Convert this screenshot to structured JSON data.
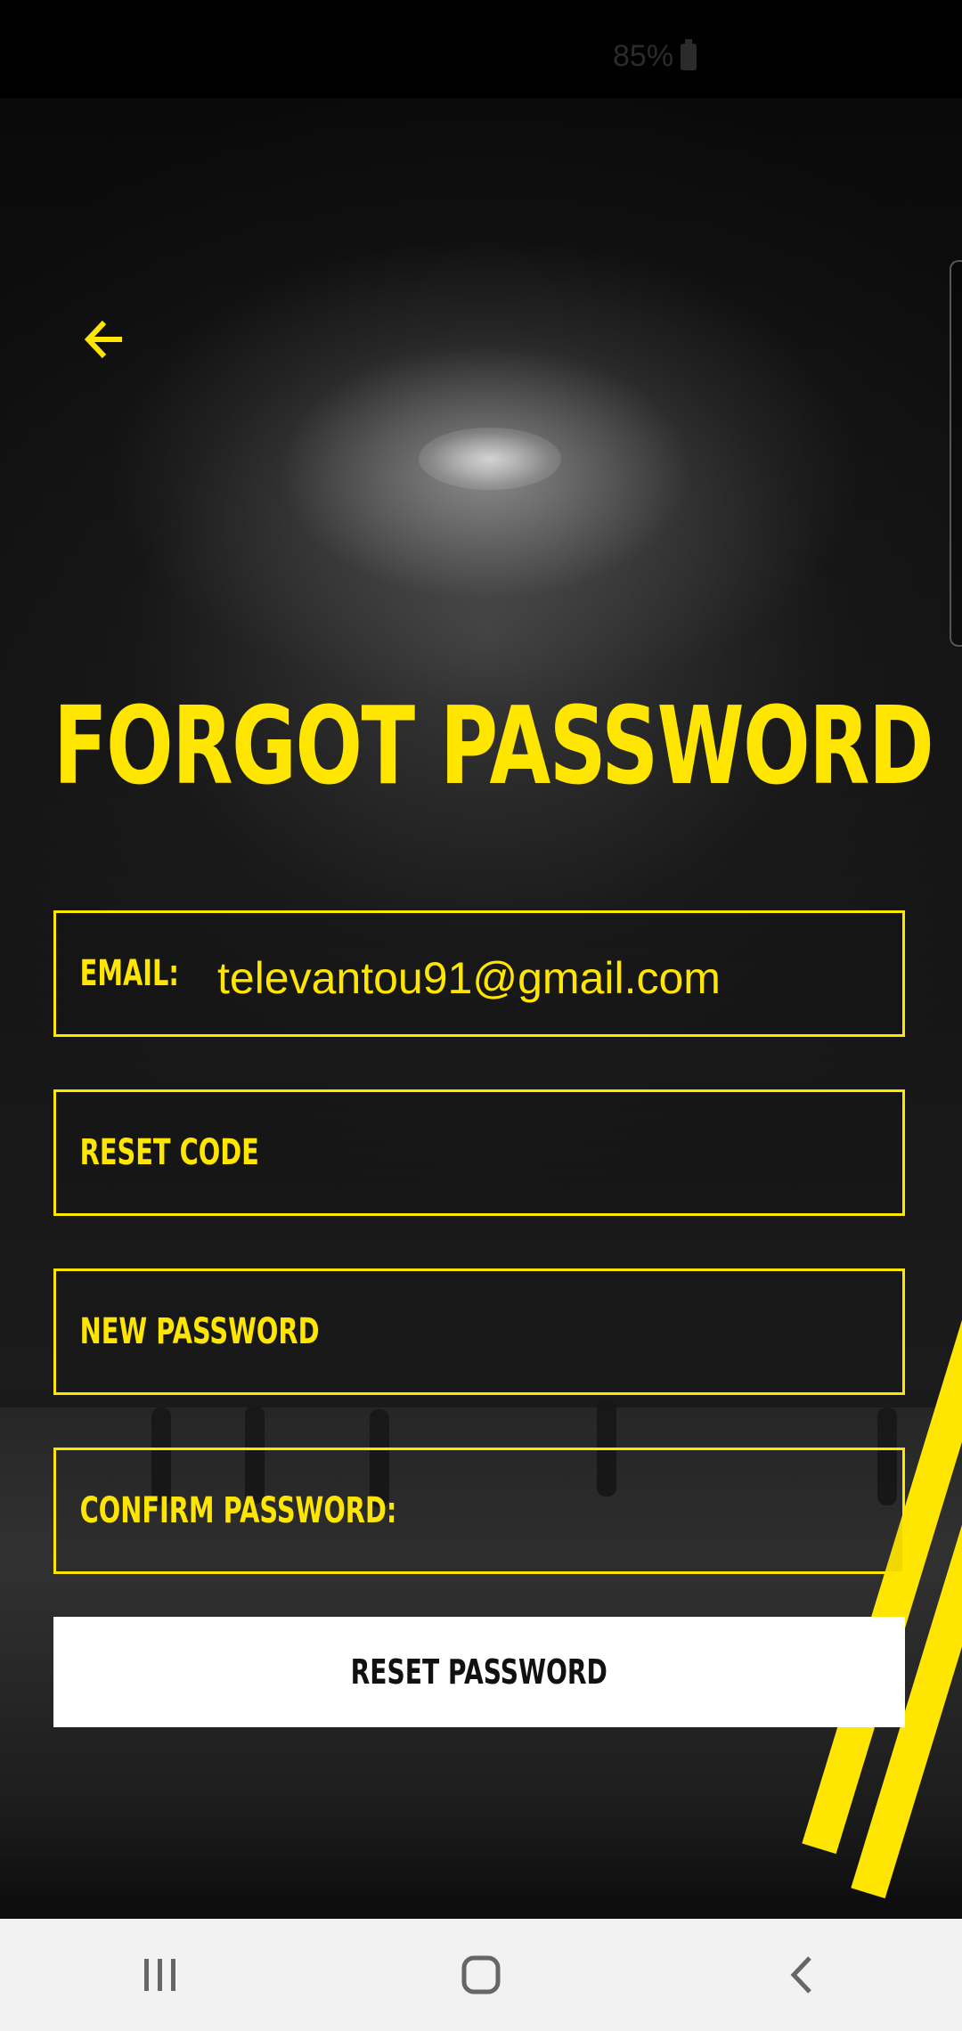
{
  "status_bar": {
    "battery_text": "85%"
  },
  "screen": {
    "title": "FORGOT PASSWORD",
    "email_label": "EMAIL:",
    "email_value": "televantou91@gmail.com",
    "reset_code_placeholder": "RESET CODE",
    "new_password_placeholder": "NEW PASSWORD",
    "confirm_password_placeholder": "CONFIRM PASSWORD:",
    "reset_button_label": "RESET PASSWORD"
  },
  "icons": {
    "back": "back-arrow-icon",
    "recents": "recent-apps-icon",
    "home": "home-icon",
    "nav_back": "chevron-left-icon"
  },
  "colors": {
    "accent": "#ffe600",
    "background": "#0b0b0b",
    "button_bg": "#ffffff",
    "nav_bar_bg": "#f2f2f2"
  }
}
